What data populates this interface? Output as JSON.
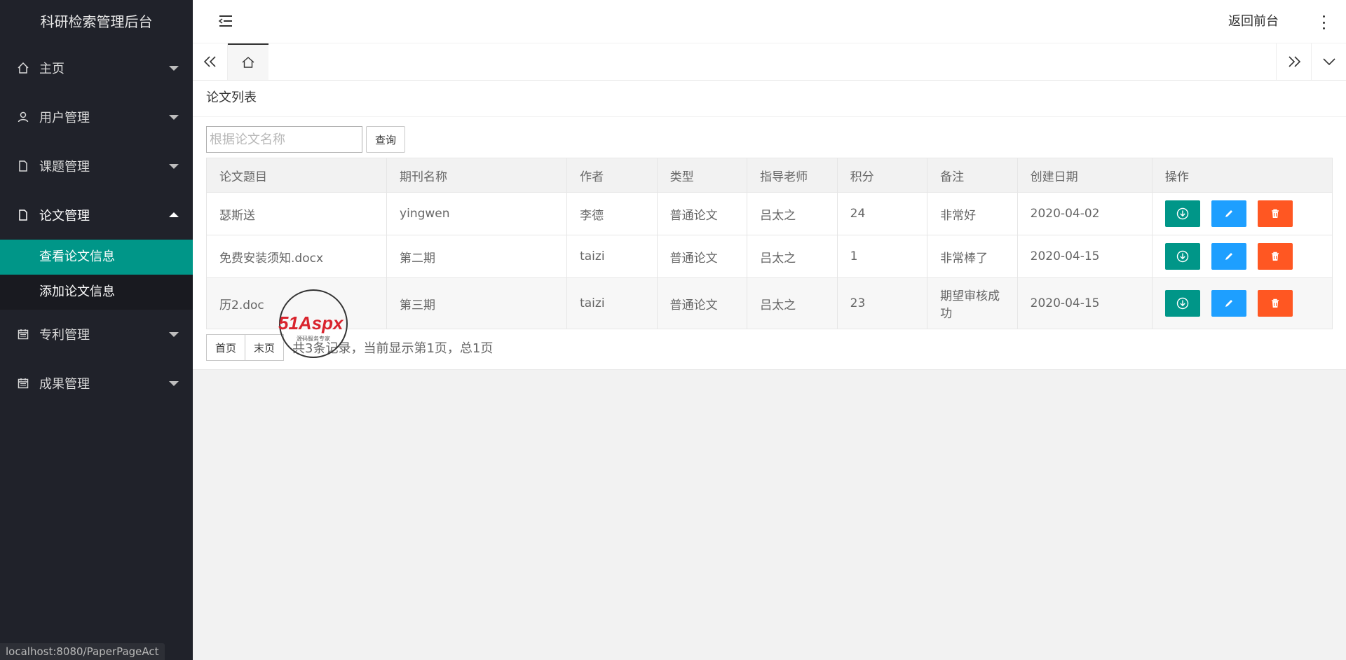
{
  "sidebar": {
    "logo": "科研检索管理后台",
    "items": [
      {
        "label": "主页"
      },
      {
        "label": "用户管理"
      },
      {
        "label": "课题管理"
      },
      {
        "label": "论文管理",
        "sub": [
          {
            "label": "查看论文信息"
          },
          {
            "label": "添加论文信息"
          }
        ]
      },
      {
        "label": "专利管理"
      },
      {
        "label": "成果管理"
      }
    ],
    "active_color": "#009688"
  },
  "header": {
    "back_label": "返回前台"
  },
  "card": {
    "title": "论文列表",
    "search_placeholder": "根据论文名称",
    "search_button": "查询",
    "columns": [
      "论文题目",
      "期刊名称",
      "作者",
      "类型",
      "指导老师",
      "积分",
      "备注",
      "创建日期",
      "操作"
    ],
    "rows": [
      [
        "瑟斯送",
        "yingwen",
        "李德",
        "普通论文",
        "吕太之",
        "24",
        "非常好",
        "2020-04-02"
      ],
      [
        "免费安装须知.docx",
        "第二期",
        "taizi",
        "普通论文",
        "吕太之",
        "1",
        "非常棒了",
        "2020-04-15"
      ],
      [
        "历2.doc",
        "第三期",
        "taizi",
        "普通论文",
        "吕太之",
        "23",
        "期望审核成功",
        "2020-04-15"
      ]
    ],
    "actions": [
      "download-icon",
      "edit-icon",
      "delete-icon"
    ],
    "pager": {
      "first": "首页",
      "last": "末页",
      "info": "共3条记录，当前显示第1页，总1页"
    }
  },
  "status_url": "localhost:8080/PaperPageAct",
  "watermark": {
    "brand": "51Aspx",
    "tagline": "源码服务专家"
  }
}
